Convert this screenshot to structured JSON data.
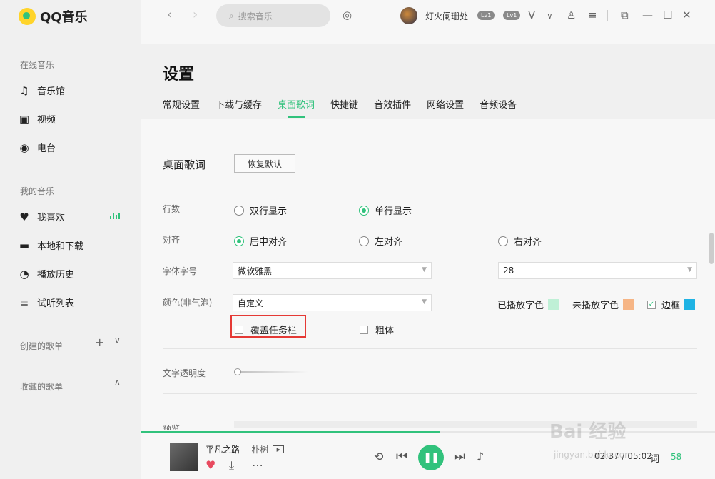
{
  "app": {
    "name": "QQ音乐"
  },
  "sidebar": {
    "online_title": "在线音乐",
    "online_items": [
      {
        "label": "音乐馆",
        "icon": "music-note-icon"
      },
      {
        "label": "视频",
        "icon": "video-icon"
      },
      {
        "label": "电台",
        "icon": "radio-icon"
      }
    ],
    "my_title": "我的音乐",
    "my_items": [
      {
        "label": "我喜欢",
        "icon": "heart-icon"
      },
      {
        "label": "本地和下载",
        "icon": "monitor-icon"
      },
      {
        "label": "播放历史",
        "icon": "clock-icon"
      },
      {
        "label": "试听列表",
        "icon": "playlist-icon"
      }
    ],
    "created_title": "创建的歌单",
    "collected_title": "收藏的歌单"
  },
  "topbar": {
    "search_placeholder": "搜索音乐",
    "username": "灯火阑珊处",
    "badge_1": "Lv1",
    "badge_2": "Lv1"
  },
  "settings": {
    "title": "设置",
    "tabs": [
      "常规设置",
      "下载与缓存",
      "桌面歌词",
      "快捷键",
      "音效插件",
      "网络设置",
      "音频设备"
    ],
    "active_tab": 2,
    "section_title": "桌面歌词",
    "restore_default": "恢复默认",
    "lines": {
      "label": "行数",
      "options": [
        "双行显示",
        "单行显示"
      ],
      "selected": 1
    },
    "align": {
      "label": "对齐",
      "options": [
        "居中对齐",
        "左对齐",
        "右对齐"
      ],
      "selected": 0
    },
    "font": {
      "label": "字体字号",
      "family": "微软雅黑",
      "size": "28"
    },
    "color": {
      "label": "颜色(非气泡)",
      "scheme": "自定义",
      "played_label": "已播放字色",
      "played_color": "#bff0d6",
      "unplayed_label": "未播放字色",
      "unplayed_color": "#f6b585",
      "border_label": "边框",
      "border_color": "#1fb3e4",
      "border_checked": true
    },
    "cover_taskbar": {
      "label": "覆盖任务栏",
      "checked": false
    },
    "bold": {
      "label": "粗体",
      "checked": false
    },
    "opacity": {
      "label": "文字透明度",
      "value": 0
    },
    "preview_label": "预览"
  },
  "player": {
    "song_title": "平凡之路",
    "separator": "-",
    "artist": "朴树",
    "mv_label": "MV",
    "current_time": "02:37",
    "total_time": "05:02",
    "time_display": "02:37 / 05:02",
    "lyric_btn": "词",
    "playlist_count": "58",
    "progress": 0.52
  },
  "watermark": {
    "main": "Bai 经验",
    "sub": "jingyan.baidu.com"
  },
  "colors": {
    "accent": "#31c27c",
    "highlight_box": "#e53935"
  }
}
